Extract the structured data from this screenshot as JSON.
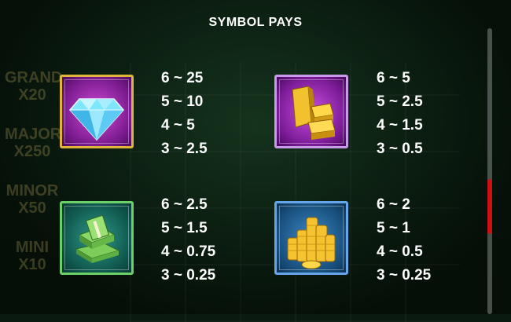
{
  "title": "SYMBOL PAYS",
  "symbols": [
    {
      "icon": "diamond-icon",
      "pays": [
        "6 ~ 25",
        "5 ~ 10",
        "4 ~ 5",
        "3 ~ 2.5"
      ]
    },
    {
      "icon": "gold-bars-icon",
      "pays": [
        "6 ~ 5",
        "5 ~ 2.5",
        "4 ~ 1.5",
        "3 ~ 0.5"
      ]
    },
    {
      "icon": "cash-stack-icon",
      "pays": [
        "6 ~ 2.5",
        "5 ~ 1.5",
        "4 ~ 0.75",
        "3 ~ 0.25"
      ]
    },
    {
      "icon": "gold-coins-icon",
      "pays": [
        "6 ~ 2",
        "5 ~ 1",
        "4 ~ 0.5",
        "3 ~ 0.25"
      ]
    }
  ],
  "background_jackpots": [
    {
      "name": "GRAND",
      "value": "X20"
    },
    {
      "name": "MAJOR",
      "value": "X250"
    },
    {
      "name": "MINOR",
      "value": "X50"
    },
    {
      "name": "MINI",
      "value": "X10"
    }
  ],
  "colors": {
    "scroll_thumb": "#cc1111",
    "title": "#ffffff"
  }
}
